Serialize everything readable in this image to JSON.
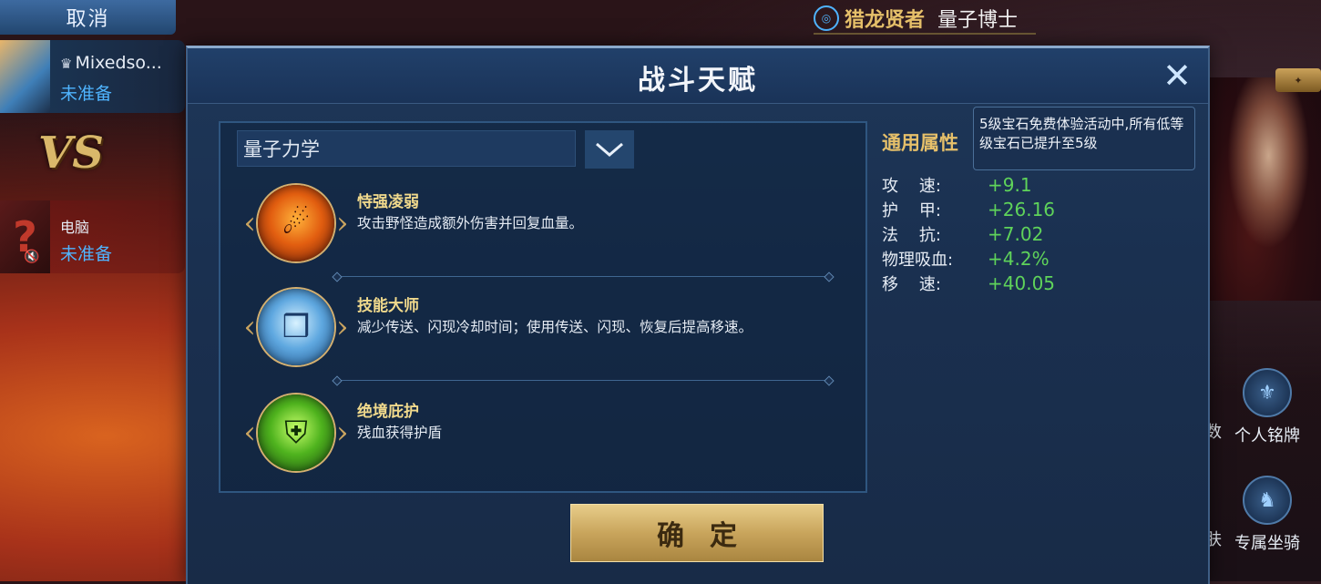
{
  "lobby": {
    "cancel_label": "取消",
    "player1": {
      "name": "Mixedso...",
      "status": "未准备",
      "crown_icon": "crown-icon"
    },
    "vs_label": "VS",
    "player2": {
      "name": "电脑",
      "status": "未准备",
      "placeholder_glyph": "?"
    }
  },
  "header": {
    "title": "猎龙贤者",
    "name": "量子博士"
  },
  "side_menu": {
    "partial1": "数",
    "item1": "个人铭牌",
    "partial2": "肤",
    "item2": "专属坐骑"
  },
  "modal": {
    "title": "战斗天赋",
    "close_glyph": "✕",
    "dropdown_value": "量子力学",
    "talents": [
      {
        "name": "恃强凌弱",
        "desc": "攻击野怪造成额外伤害并回复血量。",
        "icon": "fire-orb-icon"
      },
      {
        "name": "技能大师",
        "desc": "减少传送、闪现冷却时间；使用传送、闪现、恢复后提高移速。",
        "icon": "book-orb-icon"
      },
      {
        "name": "绝境庇护",
        "desc": "残血获得护盾",
        "icon": "shield-orb-icon"
      }
    ],
    "confirm_label": "确定",
    "attributes": {
      "title": "通用属性",
      "tooltip": "5级宝石免费体验活动中,所有低等级宝石已提升至5级",
      "rows": [
        {
          "label": "攻    速:",
          "value": "+9.1"
        },
        {
          "label": "护    甲:",
          "value": "+26.16"
        },
        {
          "label": "法    抗:",
          "value": "+7.02"
        },
        {
          "label": "物理吸血:",
          "value": "+4.2%"
        },
        {
          "label": "移    速:",
          "value": "+40.05"
        }
      ]
    }
  },
  "colors": {
    "gold": "#e6c06a",
    "blue_status": "#4fb4ff",
    "green_value": "#5fd35a"
  }
}
